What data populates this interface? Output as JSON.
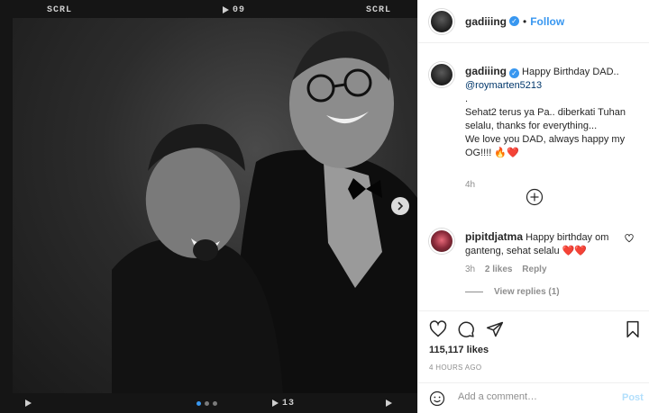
{
  "film": {
    "top_left": "SCRL",
    "top_center": "09",
    "top_right": "SCRL",
    "bottom_center": "13"
  },
  "carousel": {
    "slide_count": 3,
    "active_index": 0
  },
  "post": {
    "author": "gadiiing",
    "follow_label": "Follow",
    "separator": "•",
    "verified": true
  },
  "caption": {
    "username": "gadiiing",
    "text_line1": " Happy Birthday DAD..",
    "mention": "@roymarten5213",
    "text_rest_1": ".",
    "text_rest_2": "Sehat2 terus ya Pa.. diberkati Tuhan selalu, thanks for everything...",
    "text_rest_3": "We love you DAD, always happy my OG!!!! 🔥❤️",
    "time": "4h"
  },
  "comment": {
    "username": "pipitdjatma",
    "text": " Happy birthday om ganteng, sehat selalu ❤️❤️",
    "time": "3h",
    "likes": "2 likes",
    "reply_label": "Reply",
    "view_replies": "View replies (1)"
  },
  "stats": {
    "likes": "115,117 likes",
    "posted": "4 HOURS AGO"
  },
  "add_comment": {
    "placeholder": "Add a comment…",
    "post_label": "Post"
  },
  "colors": {
    "accent": "#3897f0",
    "muted": "#8e8e8e",
    "heart": "#ed4956",
    "post_disabled": "#b2dffc"
  }
}
